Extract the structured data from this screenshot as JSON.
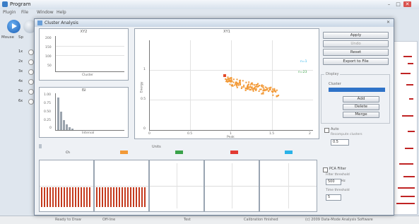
{
  "app": {
    "title": "Program",
    "menu": [
      "Plugin",
      "File",
      "Window",
      "Help"
    ],
    "window_controls": [
      "–",
      "□",
      "✕"
    ],
    "accent": "#2f6fc4"
  },
  "side": {
    "labels": [
      "Mouse",
      "Sp"
    ],
    "rows": [
      "1x",
      "2x",
      "3x",
      "4x",
      "5x",
      "6x"
    ]
  },
  "statusbar": {
    "items": [
      "Ready to Draw",
      "Off-line",
      "Test",
      "Calibration finished",
      "(c) 2009 Data-Mode Analysis Software"
    ]
  },
  "dialog": {
    "title": "Cluster Analysis",
    "close": "✕",
    "plot_main": {
      "title": "XY1",
      "xlabel": "Peak",
      "ylabel": "Energy",
      "xticks": [
        "0",
        "0.5",
        "1",
        "1.5",
        "2"
      ],
      "yticks": [
        "1",
        "0.5",
        "0"
      ],
      "legend": [
        "n=1",
        "n=23"
      ],
      "point_color": "#f29a38"
    },
    "plot_top_left": {
      "title": "XY2",
      "yticks": [
        "200",
        "150",
        "100",
        "50"
      ],
      "xlabel": "Cluster"
    },
    "plot_bottom_left": {
      "title": "ISI",
      "yticks": [
        "1.00",
        "0.75",
        "0.50",
        "0.25",
        "0"
      ],
      "xlabel": "Interval"
    },
    "waveforms": {
      "header": "Units",
      "channels": [
        {
          "label": "Ch",
          "color": "#f29a38"
        },
        {
          "label": "Ch",
          "color": "#3aa24a"
        },
        {
          "label": "Ch",
          "color": "#e23a32"
        },
        {
          "label": "Ch",
          "color": "#2ab2e8"
        }
      ],
      "raster_color": "#c43a1e"
    },
    "buttons": {
      "apply": "Apply",
      "undo": "Undo",
      "reset": "Reset",
      "export": "Export to File"
    },
    "options": {
      "group_title": "Display",
      "cluster_label": "Cluster",
      "selected_bar_color": "#2f73c8",
      "small_buttons": [
        "Add",
        "Delete",
        "Merge"
      ],
      "check_label": "Auto",
      "check_sub": "Recompute clusters",
      "value": "0.5"
    },
    "filter": {
      "show_label": "PCA Filter",
      "lower_label": "Filter threshold",
      "lower_value": "500",
      "lower_unit": "Hz",
      "upper_label": "Time threshold",
      "upper_value": "5"
    }
  }
}
